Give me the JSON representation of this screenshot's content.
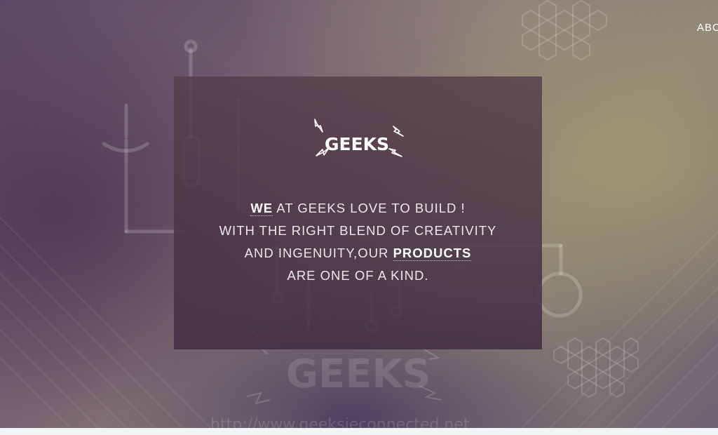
{
  "nav": {
    "about_label": "ABOUT"
  },
  "logo": {
    "text": "GEEKS"
  },
  "hero": {
    "line1_highlight": "WE",
    "line1_rest": " AT GEEKS LOVE TO BUILD !",
    "line2": "WITH THE RIGHT BLEND OF CREATIVITY",
    "line3_start": "AND INGENUITY,OUR ",
    "line3_highlight": "PRODUCTS",
    "line4": "ARE ONE OF A KIND."
  },
  "background": {
    "watermark_logo": "GEEKS",
    "watermark_url": "http://www.geeksieconnected.net"
  },
  "colors": {
    "card_top": "#553e48",
    "card_bottom": "#422c42",
    "text": "#ece8ea"
  }
}
